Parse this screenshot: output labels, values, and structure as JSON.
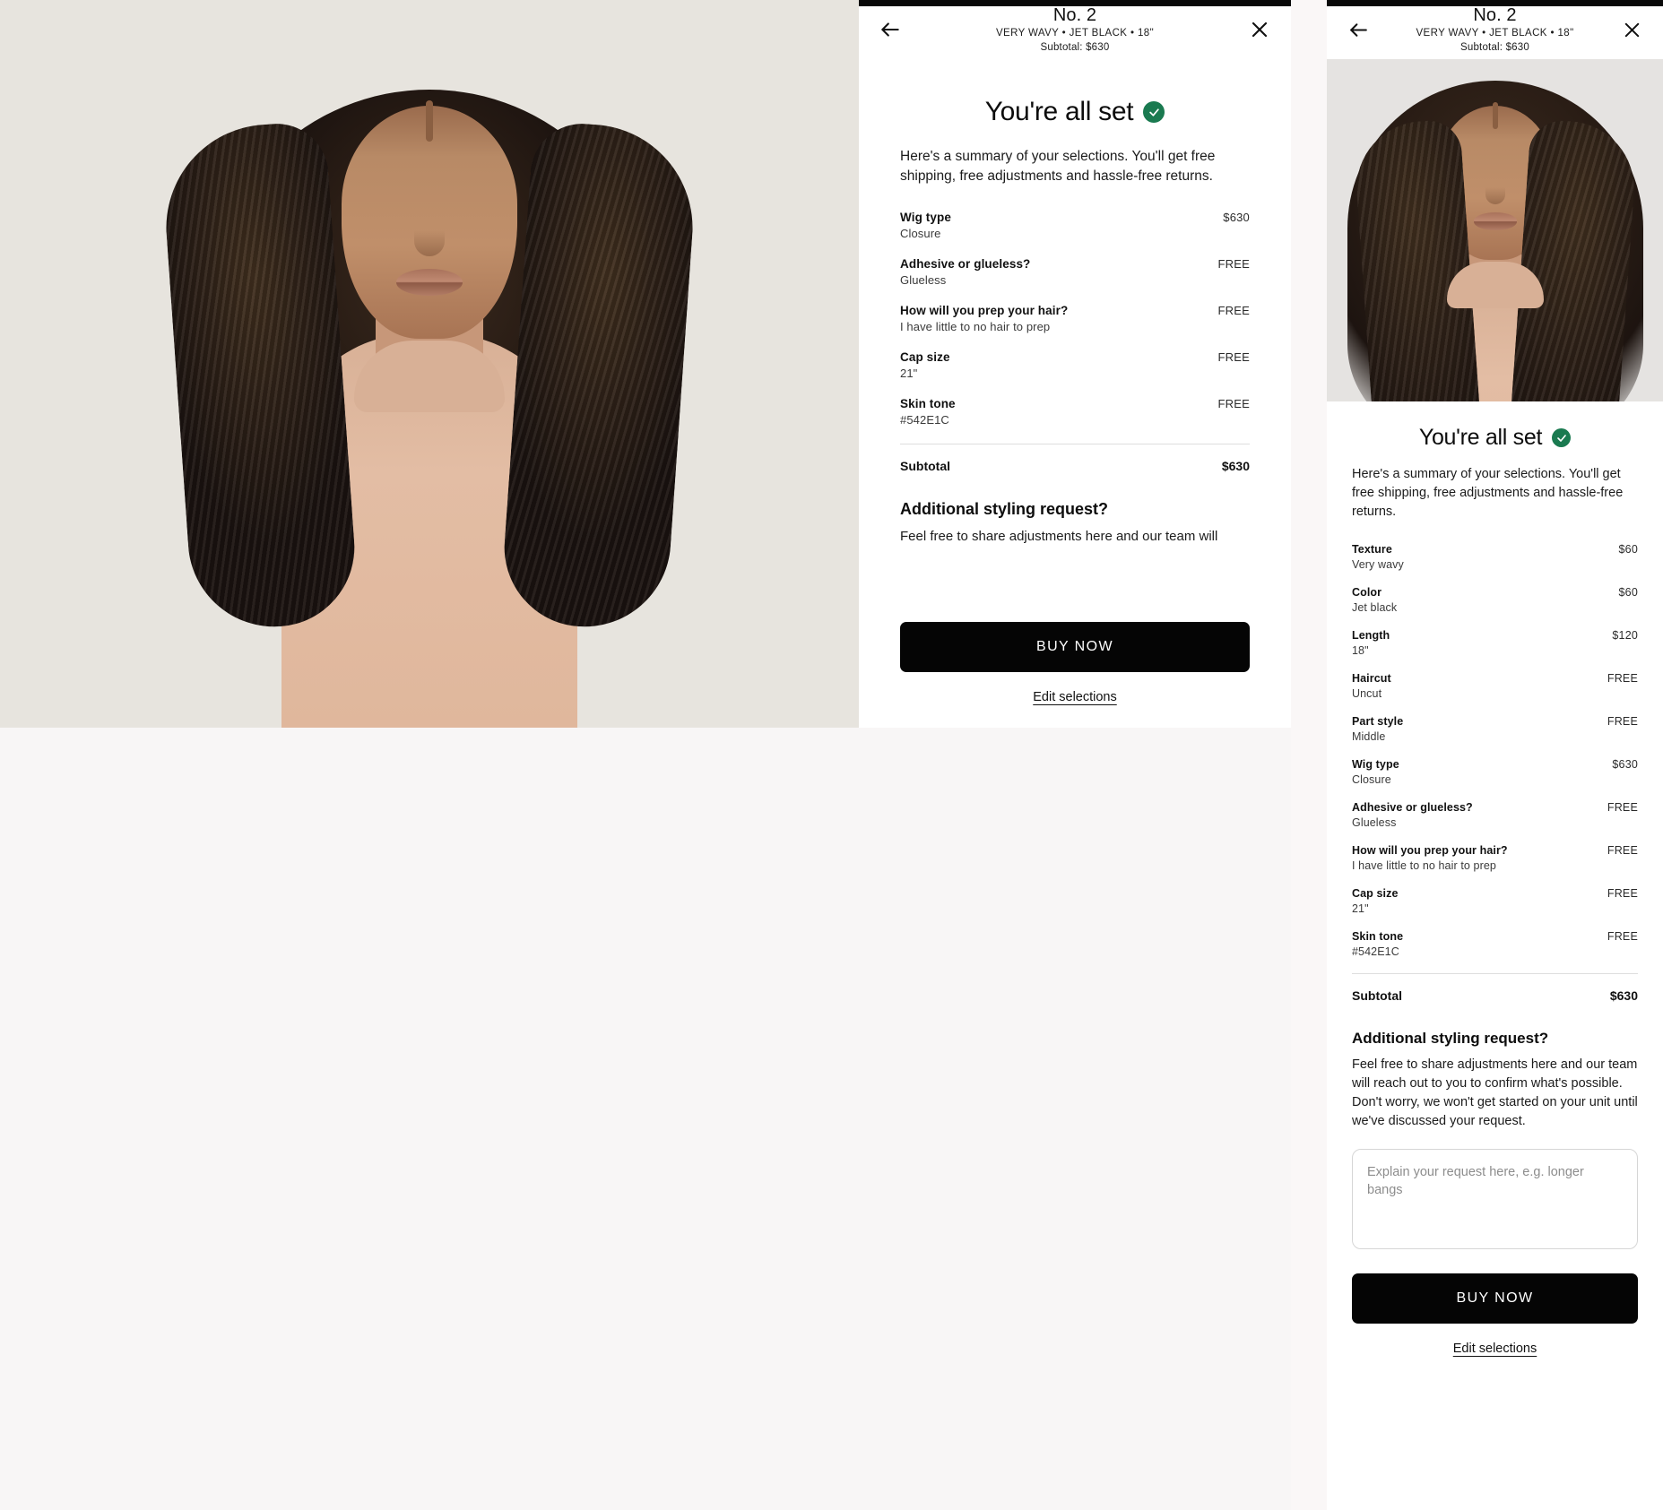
{
  "product": {
    "number": "No. 2",
    "attributes": "VERY WAVY • JET BLACK • 18\"",
    "subtotal_line": "Subtotal: $630"
  },
  "nav": {
    "back_icon": "arrow-left-icon",
    "close_icon": "close-icon"
  },
  "headline": {
    "title": "You're all set",
    "badge_icon": "check-circle-icon",
    "badge_color": "#1a7a50"
  },
  "intro_middle": "Here's a summary of your selections. You'll get free shipping, free adjustments and hassle-free returns.",
  "intro_right": "Here's a summary of your selections. You'll get free shipping, free adjustments and hassle-free returns.",
  "middle_items": [
    {
      "label": "Wig type",
      "value": "Closure",
      "price": "$630"
    },
    {
      "label": "Adhesive or glueless?",
      "value": "Glueless",
      "price": "FREE"
    },
    {
      "label": "How will you prep your hair?",
      "value": "I have little to no hair to prep",
      "price": "FREE"
    },
    {
      "label": "Cap size",
      "value": "21\"",
      "price": "FREE"
    },
    {
      "label": "Skin tone",
      "value": "#542E1C",
      "price": "FREE"
    }
  ],
  "right_items": [
    {
      "label": "Texture",
      "value": "Very wavy",
      "price": "$60"
    },
    {
      "label": "Color",
      "value": "Jet black",
      "price": "$60"
    },
    {
      "label": "Length",
      "value": "18\"",
      "price": "$120"
    },
    {
      "label": "Haircut",
      "value": "Uncut",
      "price": "FREE"
    },
    {
      "label": "Part style",
      "value": "Middle",
      "price": "FREE"
    },
    {
      "label": "Wig type",
      "value": "Closure",
      "price": "$630"
    },
    {
      "label": "Adhesive or glueless?",
      "value": "Glueless",
      "price": "FREE"
    },
    {
      "label": "How will you prep your hair?",
      "value": "I have little to no hair to prep",
      "price": "FREE"
    },
    {
      "label": "Cap size",
      "value": "21\"",
      "price": "FREE"
    },
    {
      "label": "Skin tone",
      "value": "#542E1C",
      "price": "FREE"
    }
  ],
  "subtotal": {
    "label": "Subtotal",
    "price": "$630"
  },
  "styling": {
    "title": "Additional styling request?",
    "body_middle": "Feel free to share adjustments here and our team will",
    "body_right": "Feel free to share adjustments here and our team will reach out to you to confirm what's possible. Don't worry, we won't get started on your unit until we've discussed your request.",
    "placeholder": "Explain your request here, e.g. longer bangs",
    "value": ""
  },
  "actions": {
    "buy_label": "BUY NOW",
    "edit_label": "Edit selections"
  },
  "colors": {
    "accent_green": "#1a7a50",
    "button_black": "#050505",
    "page_bg": "#f8f6f6",
    "image_bg": "#e7e4de"
  }
}
